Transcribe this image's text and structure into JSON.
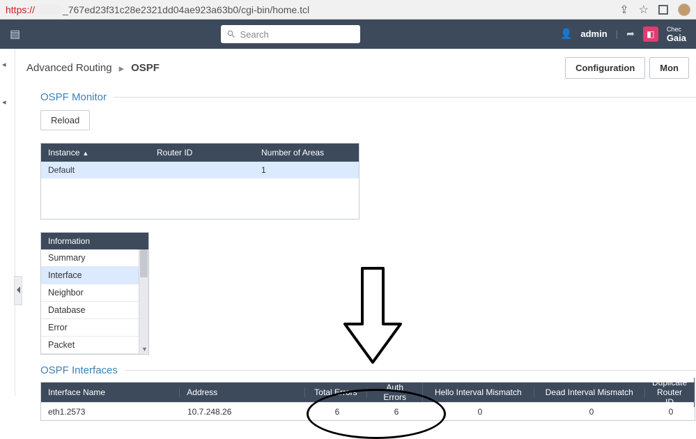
{
  "url": {
    "protocol": "https://",
    "host_hidden": " ",
    "path": "_767ed23f31c28e2321dd04ae923a63b0/cgi-bin/home.tcl"
  },
  "topbar": {
    "search_placeholder": "Search",
    "username": "admin",
    "brand_small": "Chec",
    "brand_main": "Gaia"
  },
  "breadcrumb": {
    "parent": "Advanced Routing",
    "current": "OSPF"
  },
  "mode_buttons": {
    "config": "Configuration",
    "monitor": "Mon"
  },
  "ospf_monitor": {
    "title": "OSPF Monitor",
    "reload_label": "Reload",
    "columns": {
      "instance": "Instance",
      "router_id": "Router ID",
      "num_areas": "Number of Areas"
    },
    "row": {
      "instance": "Default",
      "router_id": "",
      "num_areas": "1"
    }
  },
  "info_list": {
    "title": "Information",
    "items": [
      "Summary",
      "Interface",
      "Neighbor",
      "Database",
      "Error",
      "Packet"
    ],
    "selected_index": 1
  },
  "ospf_interfaces": {
    "title": "OSPF Interfaces",
    "columns": {
      "ifname": "Interface Name",
      "address": "Address",
      "total_err": "Total Errors",
      "auth_err": "Auth Errors",
      "hello_mm": "Hello Interval Mismatch",
      "dead_mm": "Dead Interval Mismatch",
      "dup_rid": "Duplicate Router ID"
    },
    "row": {
      "ifname": "eth1.2573",
      "address": "10.7.248.26",
      "total_err": "6",
      "auth_err": "6",
      "hello_mm": "0",
      "dead_mm": "0",
      "dup_rid": "0"
    }
  }
}
